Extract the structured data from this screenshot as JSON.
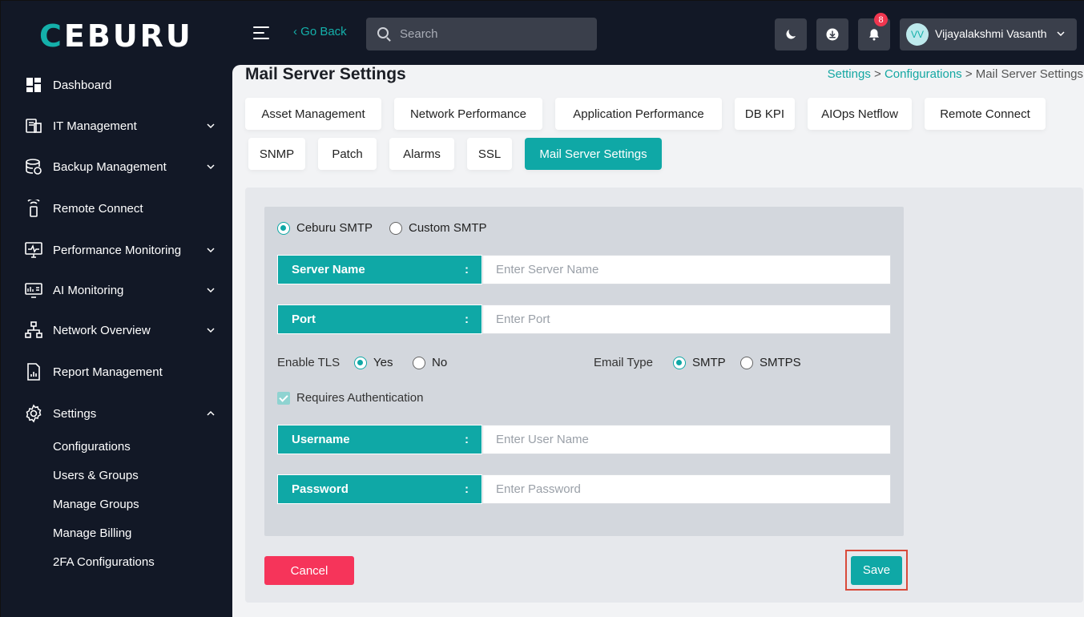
{
  "app": {
    "logo": "CEBURU",
    "go_back": "‹ Go Back",
    "search_placeholder": "Search",
    "notification_count": "8",
    "user_initials": "VV",
    "user_name": "Vijayalakshmi Vasanth",
    "accent_color": "#0fa8a6"
  },
  "sidebar": {
    "items": [
      {
        "label": "Dashboard",
        "icon": "dashboard-icon"
      },
      {
        "label": "IT Management",
        "icon": "it-management-icon"
      },
      {
        "label": "Backup Management",
        "icon": "backup-icon"
      },
      {
        "label": "Remote Connect",
        "icon": "remote-icon"
      },
      {
        "label": "Performance Monitoring",
        "icon": "monitor-icon"
      },
      {
        "label": "AI Monitoring",
        "icon": "ai-monitor-icon"
      },
      {
        "label": "Network Overview",
        "icon": "network-icon"
      },
      {
        "label": "Report Management",
        "icon": "report-icon"
      },
      {
        "label": "Settings",
        "icon": "gear-icon"
      }
    ],
    "settings_sub": [
      "Configurations",
      "Users & Groups",
      "Manage Groups",
      "Manage Billing",
      "2FA Configurations"
    ]
  },
  "page": {
    "title": "Mail Server Settings",
    "breadcrumb": {
      "crumb1": "Settings",
      "sep": ">",
      "crumb2": "Configurations",
      "crumb3": "Mail Server Settings"
    },
    "tabs": [
      "Asset Management",
      "Network Performance",
      "Application Performance",
      "DB KPI",
      "AIOps Netflow",
      "Remote Connect",
      "SNMP",
      "Patch",
      "Alarms",
      "SSL",
      "Mail Server Settings"
    ],
    "active_tab": "Mail Server Settings"
  },
  "form": {
    "smtp_option_1": "Ceburu SMTP",
    "smtp_option_2": "Custom SMTP",
    "server_name_label": "Server Name",
    "server_name_placeholder": "Enter Server Name",
    "port_label": "Port",
    "port_placeholder": "Enter Port",
    "colon": ":",
    "enable_tls_label": "Enable TLS",
    "tls_yes": "Yes",
    "tls_no": "No",
    "email_type_label": "Email Type",
    "email_smtp": "SMTP",
    "email_smtps": "SMTPS",
    "requires_auth": "Requires Authentication",
    "username_label": "Username",
    "username_placeholder": "Enter User Name",
    "password_label": "Password",
    "password_placeholder": "Enter Password",
    "cancel": "Cancel",
    "save": "Save"
  }
}
